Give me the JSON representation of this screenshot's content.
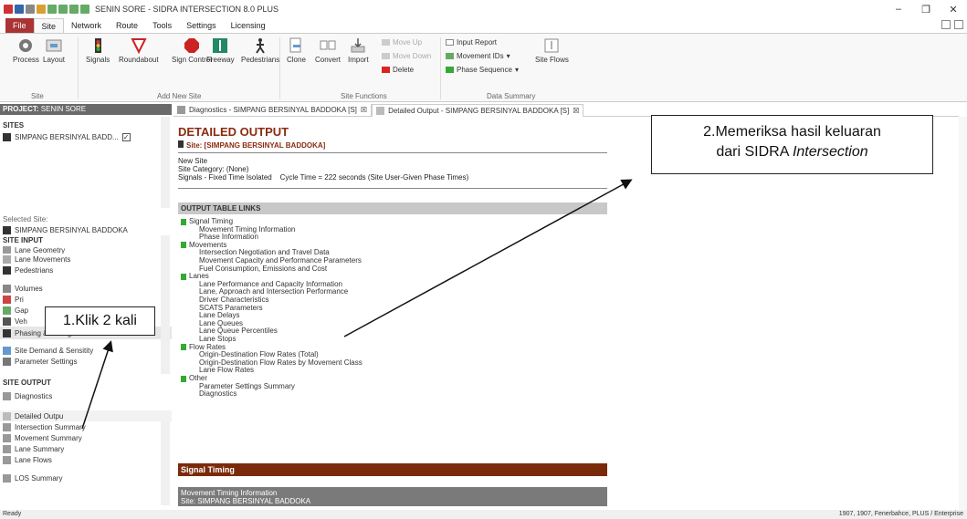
{
  "window": {
    "title": "SENIN SORE - SIDRA INTERSECTION 8.0 PLUS"
  },
  "menu": [
    "File",
    "Site",
    "Network",
    "Route",
    "Tools",
    "Settings",
    "Licensing"
  ],
  "ribbon": {
    "site": {
      "process": "Process",
      "layout": "Layout",
      "group": "Site"
    },
    "add_new_site": {
      "signals": "Signals",
      "roundabout": "Roundabout",
      "sign_control": "Sign Control",
      "freeway": "Freeway",
      "pedestrians": "Pedestrians",
      "group": "Add New Site"
    },
    "site_functions": {
      "clone": "Clone",
      "convert": "Convert",
      "import": "Import",
      "move_up": "Move Up",
      "move_down": "Move Down",
      "delete": "Delete",
      "group": "Site Functions"
    },
    "data_summary": {
      "input_report": "Input Report",
      "movement_ids": "Movement IDs",
      "phase_sequence": "Phase Sequence",
      "site_flows": "Site Flows",
      "group": "Data Summary"
    }
  },
  "left": {
    "project_label": "PROJECT:",
    "project_name": "SENIN SORE",
    "sites_header": "SITES",
    "site_item": "SIMPANG BERSINYAL BADD...",
    "selected_label": "Selected Site:",
    "selected_site": "SIMPANG BERSINYAL BADDOKA",
    "site_input_header": "SITE INPUT",
    "site_input": [
      "Lane Geometry",
      "Lane Movements",
      "Pedestrians",
      "Volumes",
      "Pri",
      "Gap",
      "Veh",
      "Phasing & Timing",
      "Site Demand & Sensit",
      "ity",
      "Parameter Settings"
    ],
    "site_output_header": "SITE OUTPUT",
    "site_output": [
      "Diagnostics",
      "Detailed Outpu",
      "Intersection Summary",
      "Movement Summary",
      "Lane Summary",
      "Lane Flows",
      "LOS Summary"
    ]
  },
  "tabs": [
    {
      "label": "Diagnostics - SIMPANG BERSINYAL BADDOKA [S]"
    },
    {
      "label": "Detailed Output - SIMPANG BERSINYAL BADDOKA [S]"
    }
  ],
  "doc": {
    "title": "DETAILED OUTPUT",
    "site_line": "Site: [SIMPANG BERSINYAL BADDOKA]",
    "info": [
      "New Site",
      "Site Category: (None)",
      "Signals - Fixed Time Isolated    Cycle Time = 222 seconds (Site User-Given Phase Times)"
    ],
    "links_header": "OUTPUT TABLE LINKS",
    "links": [
      {
        "cat": "Signal Timing",
        "items": [
          "Movement Timing Information",
          "Phase Information"
        ]
      },
      {
        "cat": "Movements",
        "items": [
          "Intersection Negotiation and Travel Data",
          "Movement Capacity and Performance Parameters",
          "Fuel Consumption, Emissions and Cost"
        ]
      },
      {
        "cat": "Lanes",
        "items": [
          "Lane Performance and Capacity Information",
          "Lane, Approach and Intersection Performance",
          "Driver Characteristics",
          "SCATS Parameters",
          "Lane Delays",
          "Lane Queues",
          "Lane Queue Percentiles",
          "Lane Stops"
        ]
      },
      {
        "cat": "Flow Rates",
        "items": [
          "Origin-Destination Flow Rates (Total)",
          "Origin-Destination Flow Rates by Movement Class",
          "Lane Flow Rates"
        ]
      },
      {
        "cat": "Other",
        "items": [
          "Parameter Settings Summary",
          "Diagnostics"
        ]
      }
    ],
    "signal_timing": "Signal Timing",
    "mti_title": "Movement Timing Information",
    "mti_site": "Site: SIMPANG BERSINYAL BADDOKA"
  },
  "annotations": {
    "callout_line1": "2.Memeriksa hasil keluaran",
    "callout_line2_pre": "dari SIDRA ",
    "callout_line2_it": "Intersection",
    "label1": "1.Klik 2 kali"
  },
  "status": {
    "left": "Ready",
    "right": "1907, 1907, Fenerbahce, PLUS / Enterprise"
  },
  "colors": {
    "brand": "#8b2b10",
    "file_tab": "#aa3333"
  }
}
